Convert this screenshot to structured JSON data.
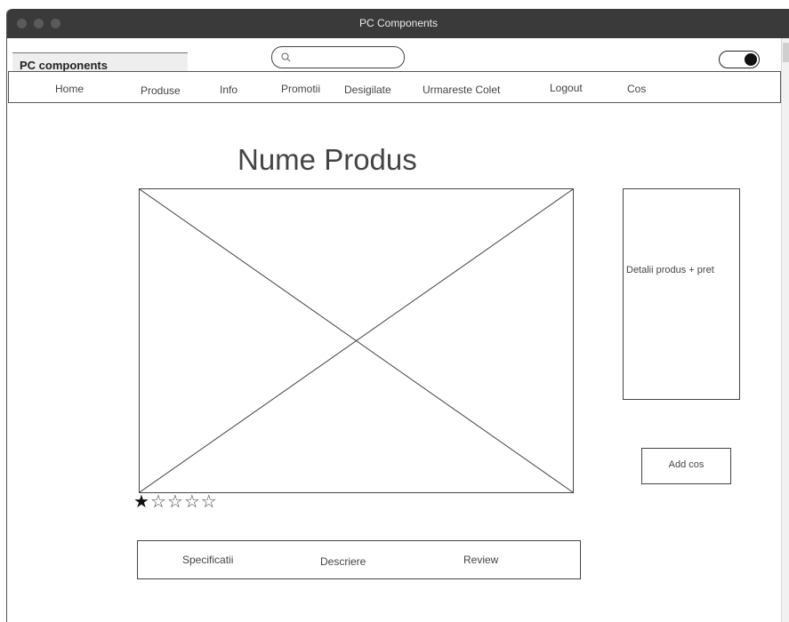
{
  "window": {
    "title": "PC Components"
  },
  "header": {
    "logo_text": "PC components",
    "search": {
      "placeholder": "",
      "icon": "search-icon"
    },
    "theme_toggle": {
      "state": "on"
    }
  },
  "nav": {
    "items": [
      {
        "label": "Home"
      },
      {
        "label": "Produse"
      },
      {
        "label": "Info"
      },
      {
        "label": "Promotii"
      },
      {
        "label": "Desigilate"
      },
      {
        "label": "Urmareste Colet"
      },
      {
        "label": "Logout"
      },
      {
        "label": "Cos"
      }
    ]
  },
  "product": {
    "name": "Nume Produs",
    "details_text": "Detalii produs + pret",
    "add_to_cart_label": "Add cos",
    "rating": {
      "value": 1,
      "max": 5
    }
  },
  "tabs": [
    {
      "label": "Specificatii"
    },
    {
      "label": "Descriere"
    },
    {
      "label": "Review"
    }
  ],
  "colors": {
    "titlebar": "#3a3a3a",
    "border": "#444444",
    "logo_bg": "#eeeeee"
  }
}
